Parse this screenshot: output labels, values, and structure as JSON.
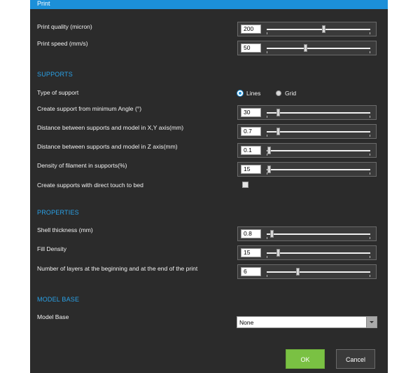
{
  "title": "Print",
  "print": {
    "quality": {
      "label": "Print quality (micron)",
      "value": "200",
      "slider_fraction": 0.55
    },
    "speed": {
      "label": "Print speed (mm/s)",
      "value": "50",
      "slider_fraction": 0.37
    }
  },
  "supports": {
    "heading": "SUPPORTS",
    "type_label": "Type of support",
    "type_options": [
      "Lines",
      "Grid"
    ],
    "type_selected": "Lines",
    "min_angle": {
      "label": "Create support from minimum Angle (°)",
      "value": "30",
      "slider_fraction": 0.11
    },
    "xy_distance": {
      "label": "Distance between supports and model in X,Y axis(mm)",
      "value": "0.7",
      "slider_fraction": 0.11
    },
    "z_distance": {
      "label": "Distance between supports and model in Z axis(mm)",
      "value": "0.1",
      "slider_fraction": 0.02
    },
    "density": {
      "label": "Density of filament in supports(%)",
      "value": "15",
      "slider_fraction": 0.02
    },
    "touch_bed": {
      "label": "Create supports with direct touch to bed",
      "checked": false
    }
  },
  "properties": {
    "heading": "PROPERTIES",
    "shell": {
      "label": "Shell thickness (mm)",
      "value": "0.8",
      "slider_fraction": 0.05
    },
    "fill": {
      "label": "Fill Density",
      "value": "15",
      "slider_fraction": 0.11
    },
    "layers": {
      "label": "Number of layers at the beginning and at the end of the print",
      "value": "6",
      "slider_fraction": 0.3
    }
  },
  "model_base": {
    "heading": "MODEL BASE",
    "label": "Model Base",
    "value": "None"
  },
  "buttons": {
    "ok": "OK",
    "cancel": "Cancel"
  },
  "colors": {
    "accent": "#1c8fd8",
    "ok_button": "#7ac143",
    "panel": "#2b2b2b",
    "section_heading": "#2aa2e8"
  }
}
